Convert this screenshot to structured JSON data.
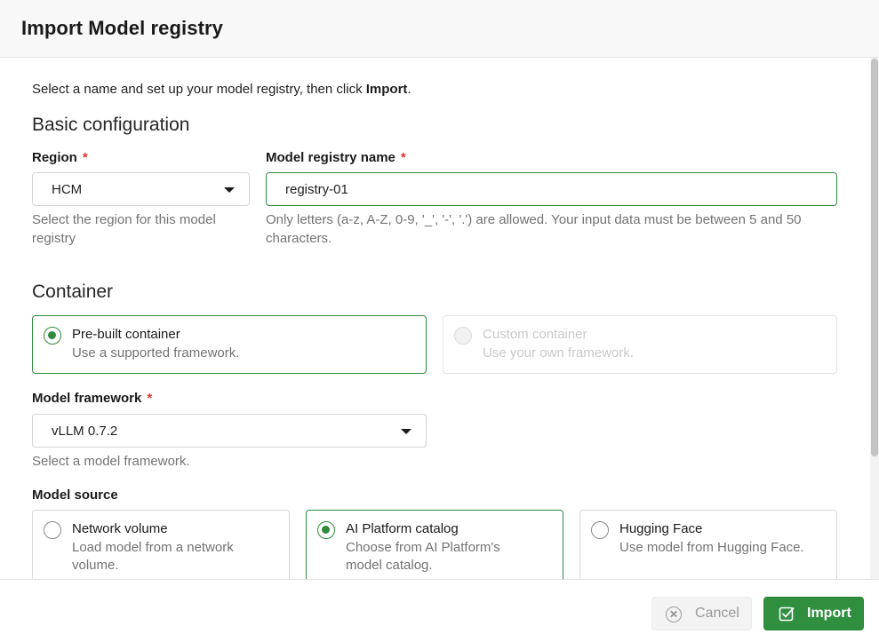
{
  "dialog": {
    "title": "Import Model registry"
  },
  "intro": {
    "text": "Select a name and set up your model registry, then click ",
    "bold": "Import",
    "end": "."
  },
  "basic": {
    "title": "Basic configuration",
    "region": {
      "label": "Region",
      "required": "*",
      "value": "HCM",
      "help": "Select the region for this model registry"
    },
    "name": {
      "label": "Model registry name",
      "required": "*",
      "value": "registry-01",
      "help": "Only letters (a-z, A-Z, 0-9, '_', '-', '.') are allowed. Your input data must be between 5 and 50 characters."
    }
  },
  "container": {
    "title": "Container",
    "options": [
      {
        "title": "Pre-built container",
        "desc": "Use a supported framework.",
        "selected": true,
        "disabled": false
      },
      {
        "title": "Custom container",
        "desc": "Use your own framework.",
        "selected": false,
        "disabled": true
      }
    ],
    "framework": {
      "label": "Model framework",
      "required": "*",
      "value": "vLLM 0.7.2",
      "help": "Select a model framework."
    }
  },
  "source": {
    "label": "Model source",
    "options": [
      {
        "title": "Network volume",
        "desc": "Load model from a network volume.",
        "selected": false
      },
      {
        "title": "AI Platform catalog",
        "desc": "Choose from AI Platform's model catalog.",
        "selected": true
      },
      {
        "title": "Hugging Face",
        "desc": "Use model from Hugging Face.",
        "selected": false
      }
    ]
  },
  "footer": {
    "cancel_label": "Cancel",
    "import_label": "Import"
  },
  "colors": {
    "accent": "#2e8b3e",
    "required": "#e03131",
    "muted": "#737373"
  }
}
